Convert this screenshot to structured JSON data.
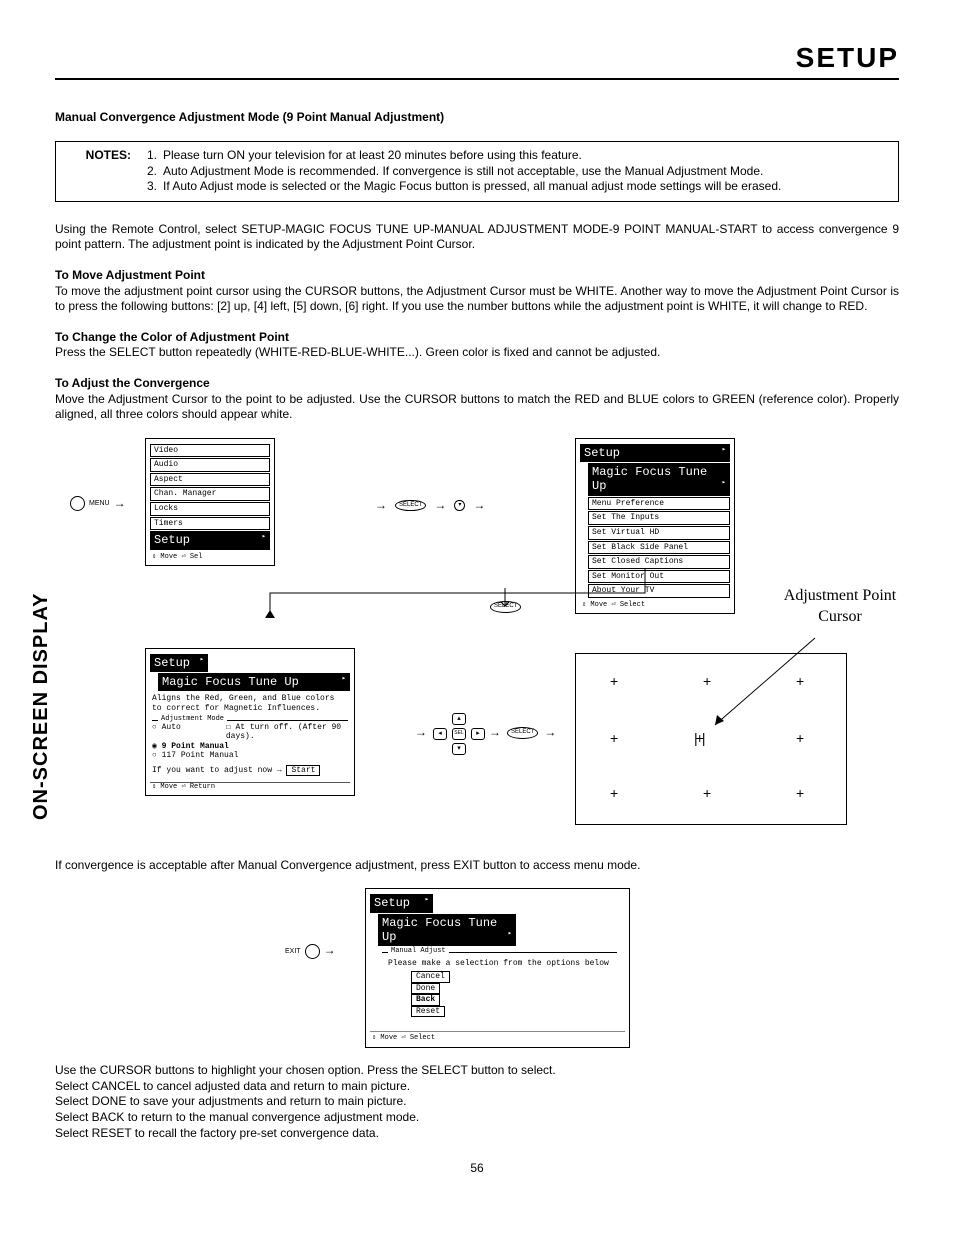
{
  "header": "SETUP",
  "sideTab": "ON-SCREEN DISPLAY",
  "pageNumber": "56",
  "sectionTitle": "Manual Convergence Adjustment Mode (9 Point Manual Adjustment)",
  "notesLabel": "NOTES:",
  "notes": [
    "Please turn ON your television for at least 20 minutes before using this feature.",
    "Auto Adjustment Mode is recommended.  If convergence is still not acceptable, use the Manual Adjustment Mode.",
    "If Auto Adjust mode is selected or the Magic Focus button is pressed, all manual adjust mode settings will be erased."
  ],
  "introPara": "Using the Remote Control, select SETUP-MAGIC FOCUS TUNE UP-MANUAL ADJUSTMENT MODE-9 POINT MANUAL-START to access convergence 9 point  pattern.  The adjustment point is indicated by the Adjustment Point Cursor.",
  "moveHeading": "To Move Adjustment Point",
  "movePara": "To move the adjustment point cursor using the CURSOR buttons, the Adjustment Cursor must be WHITE.  Another way to move the Adjustment Point Cursor is to press the following buttons:  [2] up, [4] left, [5] down, [6] right.  If you use the number buttons while the adjustment point is WHITE, it will change to RED.",
  "colorHeading": "To Change the Color of Adjustment Point",
  "colorPara": "Press the SELECT button repeatedly (WHITE-RED-BLUE-WHITE...).  Green color is fixed and cannot be adjusted.",
  "adjustHeading": "To Adjust the Convergence",
  "adjustPara": "Move the Adjustment Cursor to the point to be adjusted.  Use the CURSOR buttons to match the RED and BLUE colors to GREEN (reference color).  Properly aligned, all three colors should appear white.",
  "menuLabel": "MENU",
  "exitLabel": "EXIT",
  "adjPointLabel1": "Adjustment Point",
  "adjPointLabel2": "Cursor",
  "osd1": {
    "items": [
      "Video",
      "Audio",
      "Aspect",
      "Chan. Manager",
      "Locks",
      "Timers",
      "Setup"
    ],
    "highlight": "Setup",
    "footer": "⇕ Move  ⏎ Sel"
  },
  "osd2": {
    "title": "Setup",
    "items": [
      "Magic Focus Tune Up",
      "Menu Preference",
      "Set The Inputs",
      "Set Virtual HD",
      "Set Black Side Panel",
      "Set Closed Captions",
      "Set Monitor Out",
      "About Your TV"
    ],
    "highlight": "Magic Focus Tune Up",
    "footer": "⇕ Move  ⏎ Select"
  },
  "osd3": {
    "title": "Setup",
    "sub": "Magic Focus Tune Up",
    "desc": "Aligns the Red, Green, and Blue colors to correct for Magnetic Influences.",
    "group": "Adjustment Mode",
    "opts": {
      "auto": "Auto",
      "autoNote": "At turn off. (After 90 days).",
      "nine": "9 Point Manual",
      "p117": "117 Point Manual"
    },
    "startLine": "If you want to adjust now",
    "startBtn": "Start",
    "footer": "⇕ Move  ⏎ Return"
  },
  "afterConv": "If convergence is acceptable after Manual Convergence adjustment, press EXIT button to access menu mode.",
  "osd4": {
    "title": "Setup",
    "sub": "Magic Focus Tune Up",
    "group": "Manual Adjust",
    "prompt": "Please make a selection from the options below",
    "opts": [
      "Cancel",
      "Done",
      "Back",
      "Reset"
    ],
    "highlight": "Back",
    "footer": "⇕ Move  ⏎ Select"
  },
  "closing": [
    "Use the CURSOR buttons to highlight your chosen option.  Press the SELECT button to select.",
    "Select CANCEL to cancel adjusted data and return to main picture.",
    "Select DONE to save your adjustments and return to main picture.",
    "Select BACK to return to the manual convergence adjustment mode.",
    "Select RESET to recall the factory pre-set convergence data."
  ],
  "btnSelect": "SELECT"
}
